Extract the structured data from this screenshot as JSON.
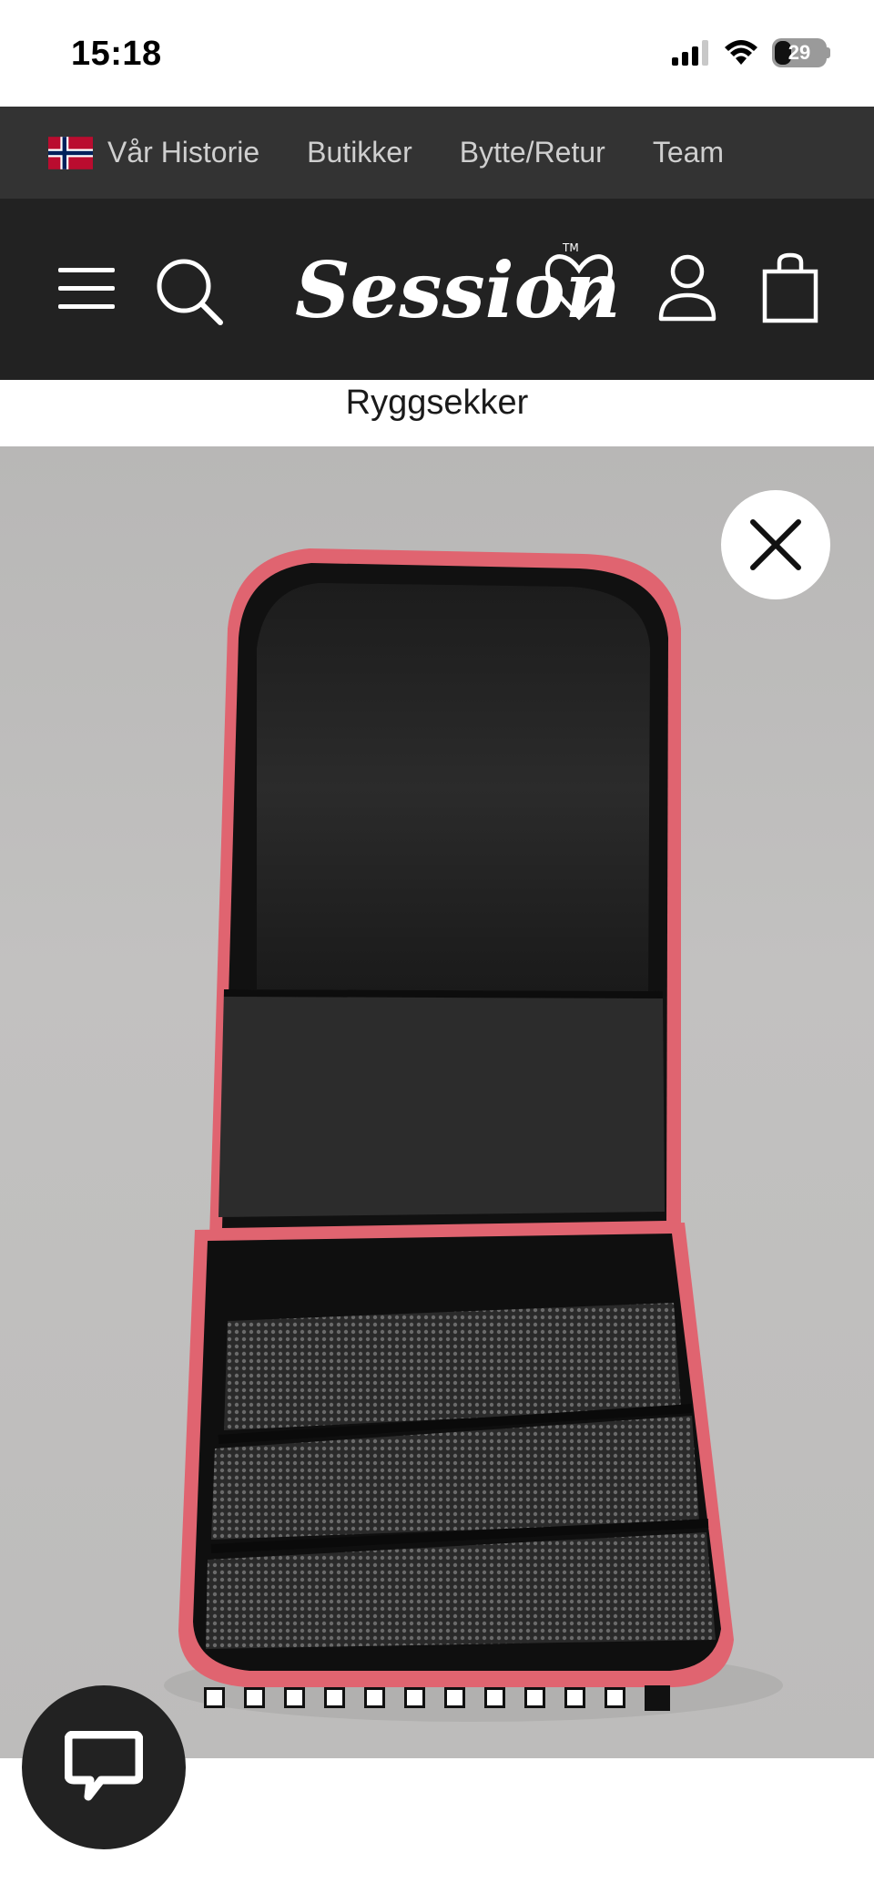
{
  "status_bar": {
    "time": "15:18",
    "battery": "29",
    "icons": [
      "signal-icon",
      "wifi-icon",
      "battery-icon"
    ]
  },
  "top_links": {
    "flag": "norway-flag-icon",
    "items": [
      {
        "label": "Vår Historie"
      },
      {
        "label": "Butikker"
      },
      {
        "label": "Bytte/Retur"
      },
      {
        "label": "Team"
      }
    ]
  },
  "header": {
    "logo_text": "Session",
    "icons": [
      "menu-icon",
      "search-icon",
      "account-icon",
      "cart-icon"
    ]
  },
  "category": {
    "title": "Ryggsekker"
  },
  "gallery": {
    "image_alt": "product-image-open-backpack",
    "close_icon": "close-icon",
    "page_count": 12,
    "active_index": 11
  },
  "chat": {
    "icon": "chat-bubble-icon"
  },
  "colors": {
    "header_bg": "#222222",
    "top_links_bg": "#333333",
    "backpack_trim": "#e06470",
    "gallery_bg": "#bdbcbb"
  }
}
